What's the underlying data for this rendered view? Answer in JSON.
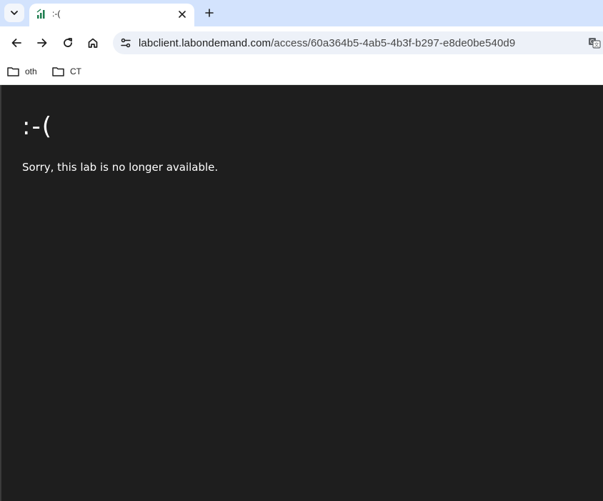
{
  "tab": {
    "title": ":-(",
    "search_icon": "chevron-down-icon",
    "favicon": "signal-bars-icon",
    "close_icon": "close-icon",
    "new_tab_icon": "plus-icon"
  },
  "toolbar": {
    "back_icon": "arrow-left-icon",
    "forward_icon": "arrow-right-icon",
    "reload_icon": "reload-icon",
    "home_icon": "home-icon",
    "site_info_icon": "tune-icon",
    "url_host": "labclient.labondemand.com",
    "url_path": "/access/60a364b5-4ab5-4b3f-b297-e8de0be540d9",
    "translate_icon": "translate-icon"
  },
  "bookmarks": [
    {
      "label": "oth",
      "icon": "folder-icon"
    },
    {
      "label": "CT",
      "icon": "folder-icon"
    }
  ],
  "page": {
    "emoticon": ":-(",
    "message": "Sorry, this lab is no longer available.",
    "background": "#1e1e1e"
  }
}
